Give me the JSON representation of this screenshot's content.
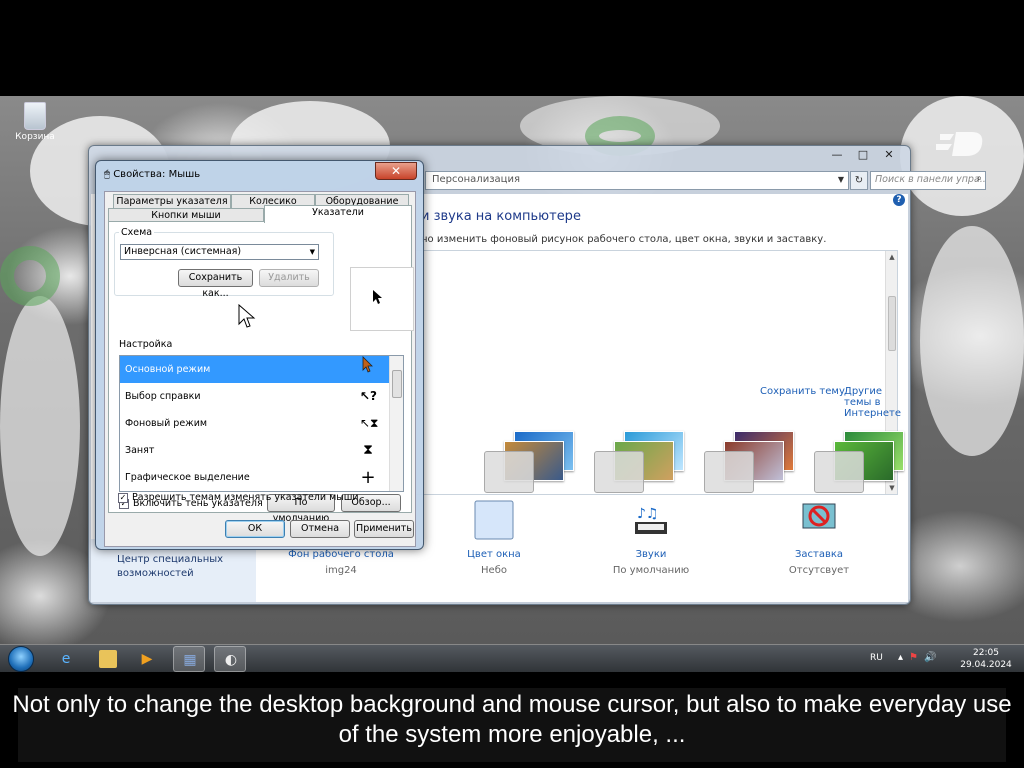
{
  "desktop": {
    "recycle_bin_label": "Корзина"
  },
  "personalization": {
    "address": "Персонализация",
    "search_placeholder": "Поиск в панели упра...",
    "heading": "и звука на компьютере",
    "description": "но изменить фоновый рисунок рабочего стола, цвет окна, звуки и заставку.",
    "save_theme": "Сохранить тему",
    "more_themes": "Другие темы в Интернете",
    "sidebar_link": "Центр специальных возможностей",
    "items": [
      {
        "title": "Фон рабочего стола",
        "value": "img24",
        "icon": "wallpaper-icon"
      },
      {
        "title": "Цвет окна",
        "value": "Небо",
        "icon": "color-icon"
      },
      {
        "title": "Звуки",
        "value": "По умолчанию",
        "icon": "sounds-icon"
      },
      {
        "title": "Заставка",
        "value": "Отсутсвует",
        "icon": "screensaver-icon"
      }
    ]
  },
  "mouse_dialog": {
    "title": "Свойства: Мышь",
    "close": "✕",
    "tabs_back": [
      "Параметры указателя",
      "Колесико",
      "Оборудование"
    ],
    "tabs_front": [
      "Кнопки мыши",
      "Указатели"
    ],
    "scheme_label": "Схема",
    "scheme_value": "Инверсная (системная)",
    "save_as": "Сохранить как...",
    "delete": "Удалить",
    "settings_label": "Настройка",
    "pointers": [
      {
        "name": "Основной режим",
        "cursor": "arrow-cursor"
      },
      {
        "name": "Выбор справки",
        "cursor": "help-cursor"
      },
      {
        "name": "Фоновый режим",
        "cursor": "working-cursor"
      },
      {
        "name": "Занят",
        "cursor": "busy-cursor"
      },
      {
        "name": "Графическое выделение",
        "cursor": "crosshair-cursor"
      }
    ],
    "shadow_checkbox": "Включить тень указателя",
    "default_btn": "По умолчанию",
    "browse_btn": "Обзор...",
    "themes_checkbox": "Разрешить темам изменять указатели мыши",
    "ok": "ОК",
    "cancel": "Отмена",
    "apply": "Применить"
  },
  "taskbar": {
    "lang": "RU",
    "time": "22:05",
    "date": "29.04.2024"
  },
  "subtitle": "Not only to change the desktop background and mouse cursor, but also to make everyday use of the system more enjoyable, ..."
}
